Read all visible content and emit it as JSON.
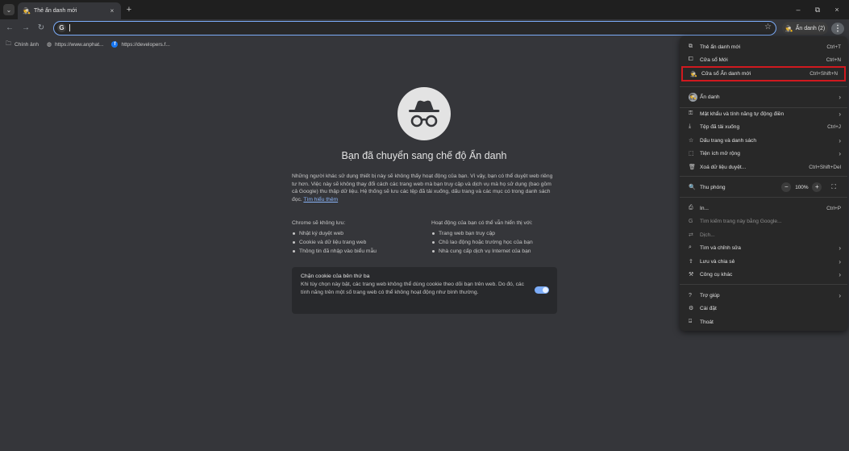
{
  "tab": {
    "title": "Thẻ ẩn danh mới",
    "close_icon": "×",
    "new_tab_icon": "+",
    "tab_search_icon": "⌄"
  },
  "window_controls": {
    "minimize": "–",
    "maximize": "⧉",
    "close": "×"
  },
  "toolbar": {
    "back_icon": "←",
    "forward_icon": "→",
    "reload_icon": "↻",
    "omnibox_value": "",
    "omnibox_search_icon": "G",
    "bookmark_star_icon": "☆",
    "incognito_label": "Ẩn danh (2)",
    "menu_icon": "⋮"
  },
  "bookmarks": [
    {
      "label": "Chính ảnh",
      "icon": "folder-icon"
    },
    {
      "label": "https://www.anphat...",
      "icon": "globe-icon"
    },
    {
      "label": "https://developers.f...",
      "icon": "facebook-icon"
    }
  ],
  "ntp": {
    "heading": "Bạn đã chuyển sang chế độ Ẩn danh",
    "intro": "Những người khác sử dụng thiết bị này sẽ không thấy hoạt động của bạn. Vì vậy, bạn có thể duyệt web riêng tư hơn. Việc này sẽ không thay đổi cách các trang web mà bạn truy cập và dịch vụ mà họ sử dụng (bao gồm cả Google) thu thập dữ liệu. Hệ thống sẽ lưu các tệp đã tải xuống, dấu trang và các mục có trong danh sách đọc.",
    "learn_more": "Tìm hiểu thêm",
    "not_saved": {
      "title": "Chrome sẽ không lưu:",
      "items": [
        "Nhật ký duyệt web",
        "Cookie và dữ liệu trang web",
        "Thông tin đã nhập vào biểu mẫu"
      ]
    },
    "visible_to": {
      "title": "Hoạt động của bạn có thể vẫn hiển thị với:",
      "items": [
        "Trang web bạn truy cập",
        "Chủ lao động hoặc trường học của bạn",
        "Nhà cung cấp dịch vụ Internet của bạn"
      ]
    },
    "cookie": {
      "title": "Chặn cookie của bên thứ ba",
      "text": "Khi tùy chọn này bật, các trang web không thể dùng cookie theo dõi bạn trên web. Do đó, các tính năng trên một số trang web có thể không hoạt động như bình thường.",
      "enabled": true
    }
  },
  "menu": {
    "items": [
      {
        "label": "Thẻ ẩn danh mới",
        "shortcut": "Ctrl+T",
        "icon": "new-tab-icon"
      },
      {
        "label": "Cửa sổ Mới",
        "shortcut": "Ctrl+N",
        "icon": "new-window-icon"
      },
      {
        "label": "Cửa sổ Ẩn danh mới",
        "shortcut": "Ctrl+Shift+N",
        "icon": "incognito-icon"
      },
      {
        "label": "Ẩn danh",
        "icon": "profile-icon"
      },
      {
        "label": "Mật khẩu và tính năng tự động điền",
        "icon": "key-icon"
      },
      {
        "label": "Tệp đã tải xuống",
        "shortcut": "Ctrl+J",
        "icon": "download-icon"
      },
      {
        "label": "Dấu trang và danh sách",
        "icon": "star-icon"
      },
      {
        "label": "Tiện ích mở rộng",
        "icon": "extension-icon"
      },
      {
        "label": "Xoá dữ liệu duyệt...",
        "shortcut": "Ctrl+Shift+Del",
        "icon": "trash-icon"
      },
      {
        "label": "Thu phóng",
        "zoom": "100%",
        "icon": "zoom-icon"
      },
      {
        "label": "In...",
        "shortcut": "Ctrl+P",
        "icon": "print-icon"
      },
      {
        "label": "Tìm kiếm trang này bằng Google...",
        "icon": "google-lens-icon"
      },
      {
        "label": "Dịch...",
        "icon": "translate-icon"
      },
      {
        "label": "Tìm và chỉnh sửa",
        "icon": "find-icon"
      },
      {
        "label": "Lưu và chia sẻ",
        "icon": "share-icon"
      },
      {
        "label": "Công cụ khác",
        "icon": "tools-icon"
      },
      {
        "label": "Trợ giúp",
        "icon": "help-icon"
      },
      {
        "label": "Cài đặt",
        "icon": "settings-icon"
      },
      {
        "label": "Thoát",
        "icon": "exit-icon"
      }
    ]
  },
  "colors": {
    "page_bg": "#35363a",
    "menu_bg": "#282828",
    "accent": "#7cacf8",
    "highlight_border": "#d0191f"
  }
}
